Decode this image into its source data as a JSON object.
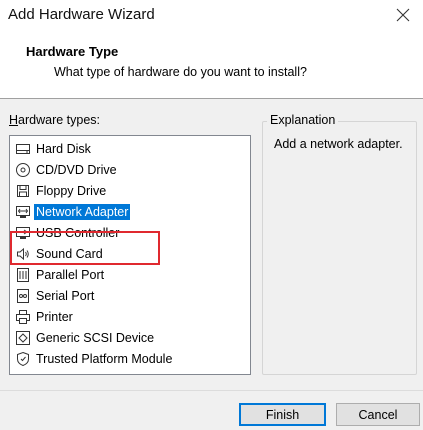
{
  "window": {
    "title": "Add Hardware Wizard"
  },
  "header": {
    "title": "Hardware Type",
    "subtitle": "What type of hardware do you want to install?"
  },
  "hardware_list": {
    "label_accel": "H",
    "label_rest": "ardware types:",
    "items": [
      {
        "label": "Hard Disk",
        "icon": "hard-disk-icon",
        "selected": false
      },
      {
        "label": "CD/DVD Drive",
        "icon": "cd-dvd-icon",
        "selected": false
      },
      {
        "label": "Floppy Drive",
        "icon": "floppy-icon",
        "selected": false
      },
      {
        "label": "Network Adapter",
        "icon": "network-adapter-icon",
        "selected": true
      },
      {
        "label": "USB Controller",
        "icon": "usb-icon",
        "selected": false
      },
      {
        "label": "Sound Card",
        "icon": "speaker-icon",
        "selected": false
      },
      {
        "label": "Parallel Port",
        "icon": "parallel-port-icon",
        "selected": false
      },
      {
        "label": "Serial Port",
        "icon": "serial-port-icon",
        "selected": false
      },
      {
        "label": "Printer",
        "icon": "printer-icon",
        "selected": false
      },
      {
        "label": "Generic SCSI Device",
        "icon": "scsi-icon",
        "selected": false
      },
      {
        "label": "Trusted Platform Module",
        "icon": "tpm-icon",
        "selected": false
      }
    ]
  },
  "explanation": {
    "legend": "Explanation",
    "text": "Add a network adapter."
  },
  "footer": {
    "finish_label": "Finish",
    "cancel_label": "Cancel"
  },
  "colors": {
    "selection": "#0078d7",
    "highlight_annotation": "#e0292f"
  }
}
